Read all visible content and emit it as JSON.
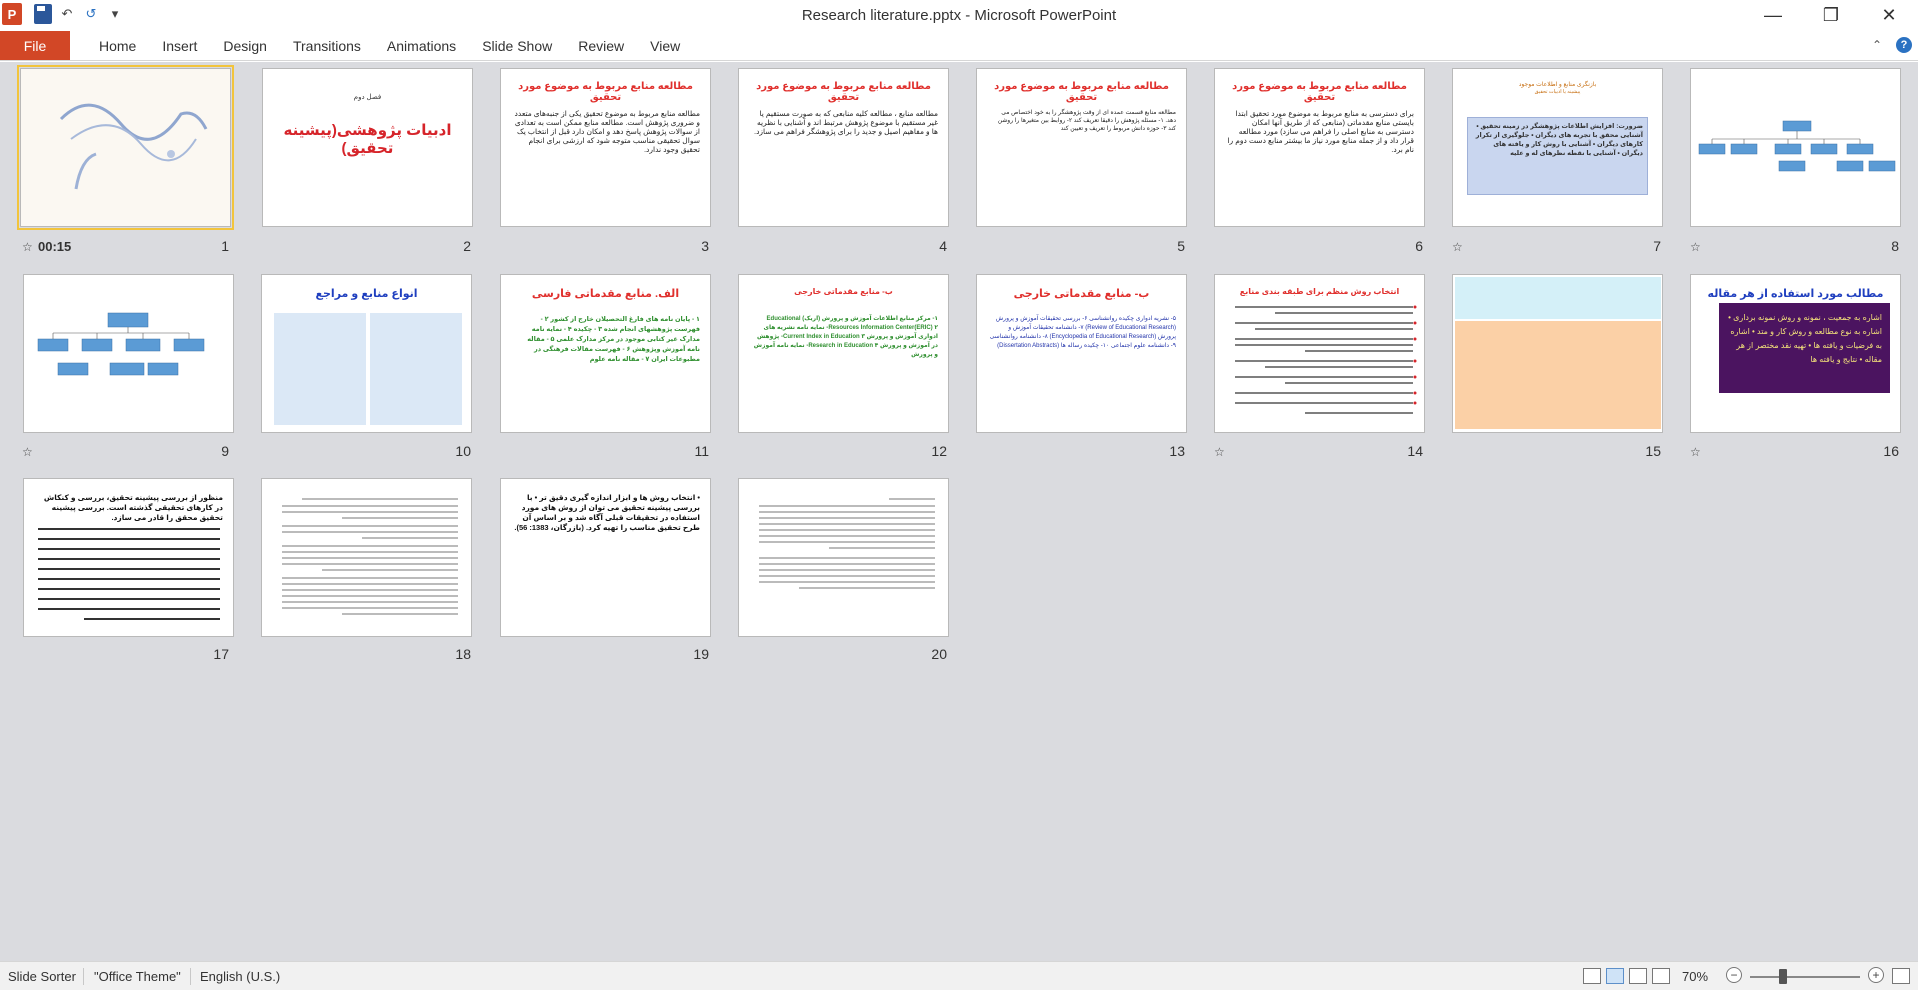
{
  "window": {
    "title": "Research literature.pptx - Microsoft PowerPoint",
    "app_icon_letter": "P",
    "minimize": "—",
    "restore": "❐",
    "close": "✕"
  },
  "qat": {
    "undo": "↶",
    "redo": "↺",
    "customize": "▾"
  },
  "ribbon": {
    "file": "File",
    "tabs": [
      "Home",
      "Insert",
      "Design",
      "Transitions",
      "Animations",
      "Slide Show",
      "Review",
      "View"
    ],
    "collapse": "⌃",
    "help": "?"
  },
  "slides": [
    {
      "num": "1",
      "timing": "00:15",
      "title": "",
      "body": "",
      "bg": "#ffffff"
    },
    {
      "num": "2",
      "title": "ادبیات پژوهشی(پیشینه تحقیق)",
      "subtitle": "فصل دوم",
      "body": ""
    },
    {
      "num": "3",
      "title": "مطالعه منابع مربوط به موضوع مورد تحقیق",
      "body": "مطالعه منابع مربوط به موضوع تحقیق یکی از جنبه‌های متعدد و ضروری پژوهش است. مطالعه منابع ممکن است به تعدادی از سوالات پژوهش پاسخ دهد و امکان دارد قبل از انتخاب یک سوال تحقیقی مناسب متوجه شود که ارزشی برای انجام تحقیق وجود ندارد."
    },
    {
      "num": "4",
      "title": "مطالعه منابع مربوط به موضوع مورد تحقیق",
      "body": "مطالعه منابع ، مطالعه کلیه منابعی که به صورت مستقیم یا غیر مستقیم با موضوع پژوهش مرتبط اند و آشنایی با نظریه ها و مفاهیم اصیل و جدید را برای پژوهشگر فراهم می سازد."
    },
    {
      "num": "5",
      "title": "مطالعه منابع مربوط به موضوع مورد تحقیق",
      "body": "مطالعه منابع قسمت عمده ای از وقت پژوهشگر را به خود اختصاص می دهد. ۱- مسئله پژوهش را دقیقا تعریف کند ۲- روابط بین متغیرها را روشن کند ۳- حوزه دانش مربوط را تعریف و تعیین کند"
    },
    {
      "num": "6",
      "title": "مطالعه منابع مربوط به موضوع مورد تحقیق",
      "body": "برای دسترسی به منابع مربوط به موضوع مورد تحقیق ابتدا بایستی منابع مقدماتی (منابعی که از طریق آنها امکان دسترسی به منابع اصلی را فراهم می سازد) مورد مطالعه قرار داد و از جمله منابع مورد نیاز ما بیشتر منابع دست دوم را نام برد."
    },
    {
      "num": "7",
      "title": "بازنگری منابع و اطلاعات موجود",
      "subtitle": "پیشینه یا ادبیات تحقیق",
      "body": "ضرورت: افزایش اطلاعات پژوهشگر در زمینه تحقیق • آشنایی محقق با تجربه های دیگران • جلوگیری از تکرار کارهای دیگران • آشنایی با روش کار و یافته های دیگران • آشنایی با نقطه نظرهای له و علیه"
    },
    {
      "num": "8",
      "title": "",
      "body": ""
    },
    {
      "num": "9",
      "title": "",
      "body": ""
    },
    {
      "num": "10",
      "title": "انواع منابع و مراجع",
      "body": ""
    },
    {
      "num": "11",
      "title": "الف. منابع مقدماتی فارسی",
      "body": "۱ - پایان نامه های فارغ التحصیلان خارج از کشور ۲ - فهرست پژوهشهای انجام شده ۳ - چکیده ۴ - نمایه نامه مدارک غیر کتابی موجود در مرکز مدارک علمی ۵ - مقاله نامه آموزش وپژوهش ۶ - فهرست مقالات فرهنگی در مطبوعات ایران ۷ - مقاله نامه علوم"
    },
    {
      "num": "12",
      "title": "ب- منابع مقدماتی خارجی",
      "body": "۱- مرکز منابع اطلاعات آموزش و پرورش (اریک) Educational Resources Information Center(ERIC) ۲- نمایه نامه نشریه های ادواری آموزش و پرورش Current Index in Education ۳- پژوهش در آموزش و پرورش Research in Education ۴- نمایه نامه آموزش و پرورش"
    },
    {
      "num": "13",
      "title": "ب- منابع مقدماتی خارجی",
      "body": "۵- نشریه ادواری چکیده روانشناسی ۶- بررسی تحقیقات آموزش و پرورش (Review of Educational Research) ۷- دانشنامه تحقیقات آموزش و پرورش (Encyclopedia of Educational Research) ۸- دانشنامه روانشناسی ۹- دانشنامه علوم اجتماعی ۱۰- چکیده رساله ها (Dissertation Abstracts)"
    },
    {
      "num": "14",
      "title": "انتخاب روش منظم برای طبقه بندی منابع",
      "body": ""
    },
    {
      "num": "15",
      "title": "",
      "body": ""
    },
    {
      "num": "16",
      "title": "مطالب مورد استفاده از هر مقاله",
      "body": "اشاره به جمعیت ، نمونه و روش نمونه برداری • اشاره به نوع مطالعه و روش کار و متد • اشاره به فرضیات و یافته ها • تهیه نقد مختصر از هر مقاله • نتایج و یافته ها"
    },
    {
      "num": "17",
      "title": "",
      "body": "منظور از بررسی پیشینه تحقیق، بررسی و کنکاش در کارهای تحقیقی گذشته است. بررسی پیشینه تحقیق محقق را قادر می سازد."
    },
    {
      "num": "18",
      "title": "",
      "body": ""
    },
    {
      "num": "19",
      "title": "",
      "body": "• انتخاب روش ها و ابزار اندازه گیری دقیق تر • با بررسی پیشینه تحقیق می توان از روش های مورد استفاده در تحقیقات قبلی آگاه شد و بر اساس آن طرح تحقیق مناسب را تهیه کرد. (بازرگان، 1383: 56)."
    },
    {
      "num": "20",
      "title": "",
      "body": ""
    }
  ],
  "status": {
    "view": "Slide Sorter",
    "theme": "\"Office Theme\"",
    "language": "English (U.S.)",
    "zoom": "70%",
    "zoom_out": "−",
    "zoom_in": "+"
  },
  "colors": {
    "file_tab": "#d24726",
    "selection": "#f2c43c",
    "sorter_bg": "#dadbdf"
  }
}
